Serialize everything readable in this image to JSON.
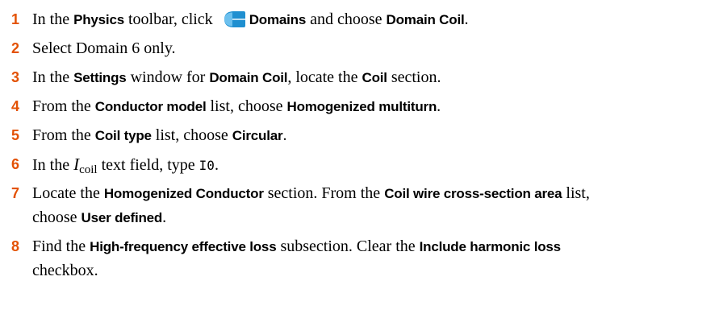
{
  "steps": [
    {
      "num": "1",
      "t1": "In the ",
      "b1": "Physics",
      "t2": " toolbar, click ",
      "icon": "domains-icon",
      "b2": "Domains",
      "t3": " and choose ",
      "b3": "Domain Coil",
      "t4": "."
    },
    {
      "num": "2",
      "t1": "Select Domain 6 only."
    },
    {
      "num": "3",
      "t1": "In the ",
      "b1": "Settings",
      "t2": " window for ",
      "b2": "Domain Coil",
      "t3": ", locate the ",
      "b3": "Coil",
      "t4": " section."
    },
    {
      "num": "4",
      "t1": "From the ",
      "b1": "Conductor model",
      "t2": " list, choose ",
      "b2": "Homogenized multiturn",
      "t3": "."
    },
    {
      "num": "5",
      "t1": "From the ",
      "b1": "Coil type",
      "t2": " list, choose ",
      "b2": "Circular",
      "t3": "."
    },
    {
      "num": "6",
      "t1": "In the ",
      "sym": "I",
      "sub": "coil",
      "t2": " text field, type ",
      "code": "I0",
      "t3": "."
    },
    {
      "num": "7",
      "t1": "Locate the ",
      "b1": "Homogenized Conductor",
      "t2": " section. From the ",
      "b2": "Coil wire cross-section area",
      "t3": " list,",
      "t4": "choose ",
      "b3": "User defined",
      "t5": "."
    },
    {
      "num": "8",
      "t1": "Find the ",
      "b1": "High-frequency effective loss",
      "t2": " subsection. Clear the ",
      "b2": "Include harmonic loss",
      "t3": "checkbox."
    }
  ],
  "colors": {
    "step_number": "#e35205",
    "icon_fill": "#1f8fd0",
    "icon_light": "#6cc0ee"
  }
}
